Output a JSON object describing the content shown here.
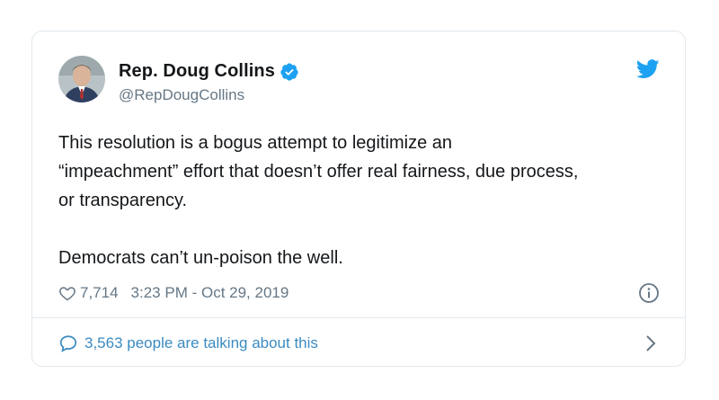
{
  "author": {
    "display_name": "Rep. Doug Collins",
    "handle": "@RepDougCollins",
    "verified": true
  },
  "tweet": {
    "text": "This resolution is a bogus attempt to legitimize an\n“impeachment” effort that doesn’t offer real fairness, due process,\nor transparency.\n\nDemocrats can’t un-poison the well."
  },
  "meta": {
    "likes": "7,714",
    "timestamp": "3:23 PM - Oct 29, 2019"
  },
  "footer": {
    "talking_text": "3,563 people are talking about this"
  },
  "icons": {
    "brand": "twitter-bird-icon",
    "verified": "verified-badge-icon",
    "like": "heart-icon",
    "info": "info-icon",
    "reply": "speech-bubble-icon",
    "more": "chevron-right-icon"
  },
  "colors": {
    "twitter_blue": "#1da1f2",
    "link_blue": "#3b8bc1",
    "text_primary": "#14171a",
    "text_secondary": "#657786",
    "border": "#e1e8ed"
  }
}
